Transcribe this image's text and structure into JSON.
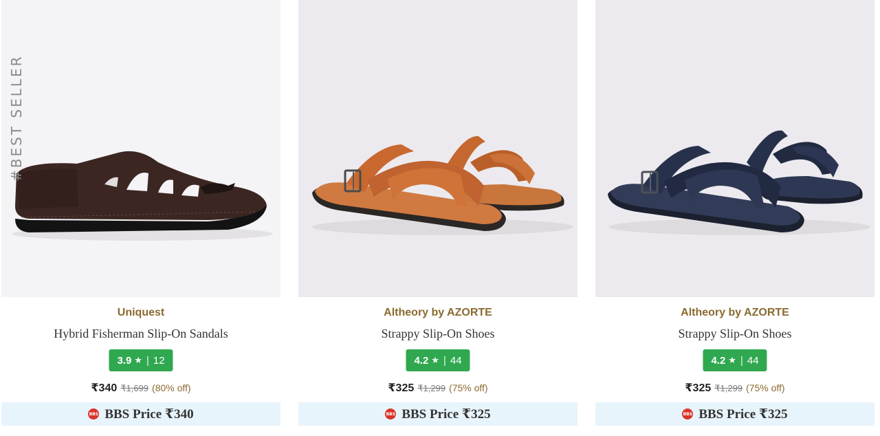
{
  "products": [
    {
      "brand": "Uniquest",
      "name": "Hybrid Fisherman Slip-On Sandals",
      "side_badge": "#BEST SELLER",
      "rating": "3.9",
      "rating_count": "12",
      "price": "₹340",
      "mrp": "₹1,699",
      "discount": "(80% off)",
      "bbs_label": "BBS Price ₹340",
      "image_colors": {
        "bg": "#f3f2f4",
        "upper": "#3a2521",
        "sole": "#151414"
      }
    },
    {
      "brand": "Altheory by AZORTE",
      "name": "Strappy Slip-On Shoes",
      "side_badge": "",
      "rating": "4.2",
      "rating_count": "44",
      "price": "₹325",
      "mrp": "₹1,299",
      "discount": "(75% off)",
      "bbs_label": "BBS Price ₹325",
      "image_colors": {
        "bg": "#eceaee",
        "upper": "#c66a31",
        "sole": "#2b2725"
      }
    },
    {
      "brand": "Altheory by AZORTE",
      "name": "Strappy Slip-On Shoes",
      "side_badge": "",
      "rating": "4.2",
      "rating_count": "44",
      "price": "₹325",
      "mrp": "₹1,299",
      "discount": "(75% off)",
      "bbs_label": "BBS Price ₹325",
      "image_colors": {
        "bg": "#eceaee",
        "upper": "#27314a",
        "sole": "#1c2130"
      }
    }
  ],
  "icons": {
    "rating_star": "star-icon",
    "bbs_badge": "bbs-badge-icon"
  },
  "colors": {
    "rating_badge": "#2fa84f",
    "brand_text": "#8a6a2f",
    "bbs_bar": "#e8f4fb",
    "bbs_icon": "#d9342b"
  }
}
